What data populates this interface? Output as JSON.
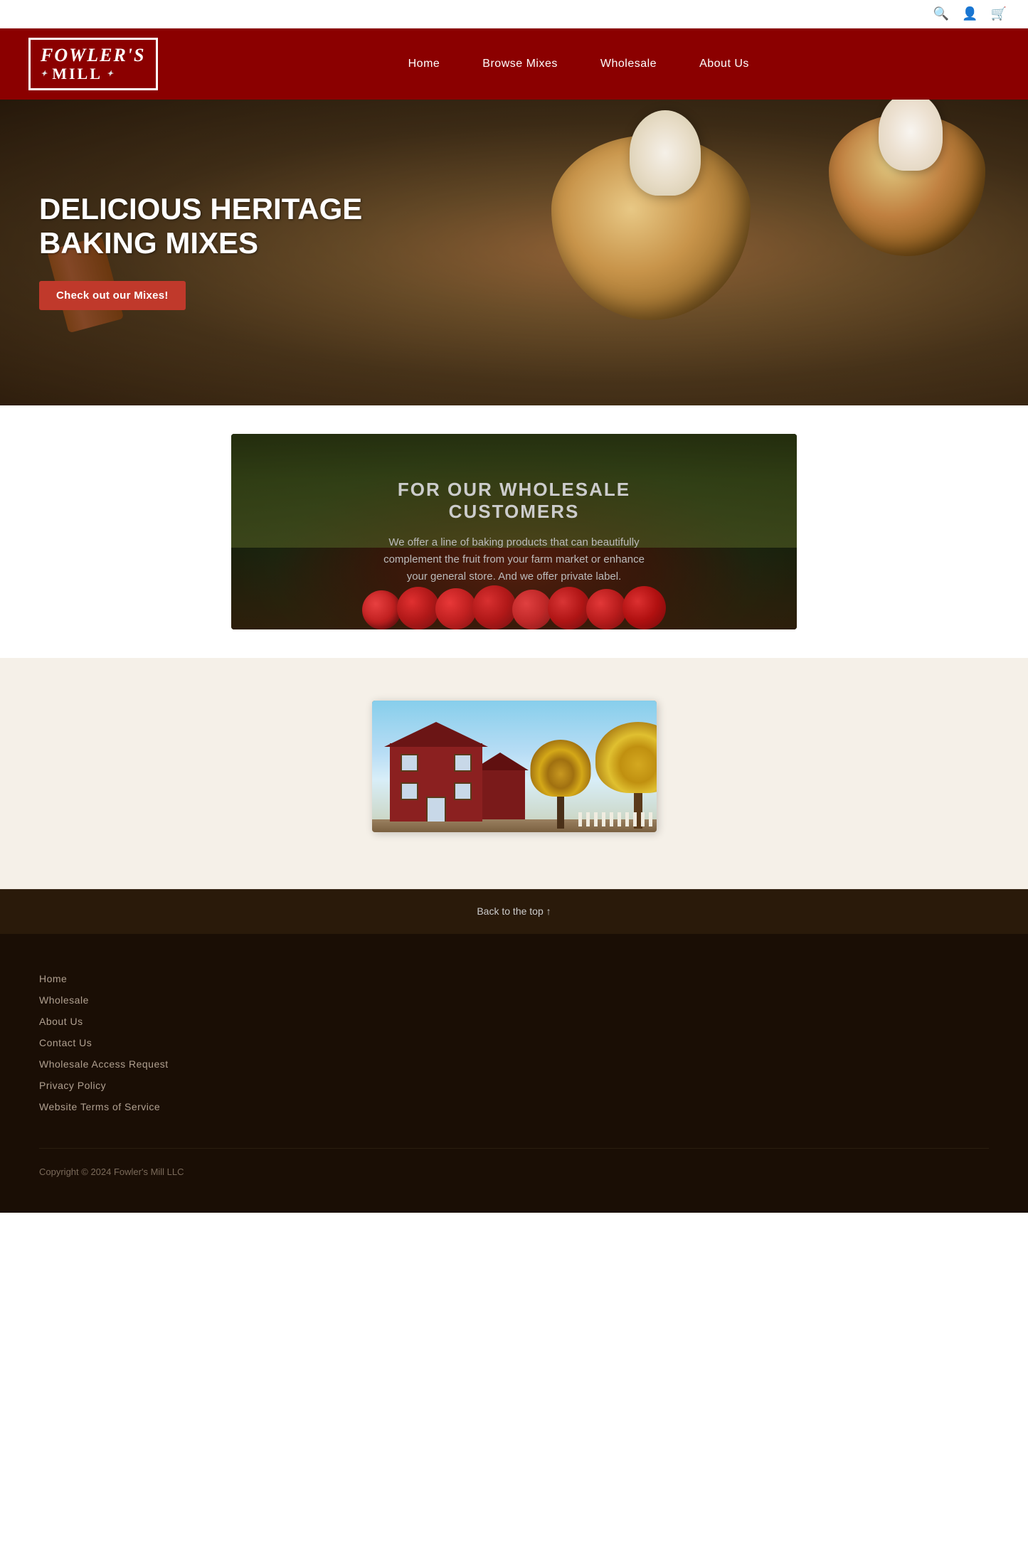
{
  "topbar": {
    "search_icon": "🔍",
    "account_icon": "👤",
    "cart_icon": "🛒"
  },
  "header": {
    "logo_line1": "Fowler's",
    "logo_line2": "Mill",
    "nav": {
      "items": [
        {
          "label": "Home",
          "href": "#"
        },
        {
          "label": "Browse Mixes",
          "href": "#"
        },
        {
          "label": "Wholesale",
          "href": "#"
        },
        {
          "label": "About Us",
          "href": "#"
        }
      ]
    }
  },
  "hero": {
    "title_line1": "DELICIOUS HERITAGE",
    "title_line2": "BAKING MIXES",
    "cta_button": "Check out our Mixes!"
  },
  "wholesale": {
    "title": "FOR OUR WHOLESALE",
    "title_line2": "CUSTOMERS",
    "description": "We offer a line of baking products that can beautifully complement the fruit from your farm market or enhance your general store. And we offer private label."
  },
  "about": {
    "image_alt": "Fowler's Mill Building in Autumn"
  },
  "footer": {
    "back_to_top": "Back to the top ↑",
    "links": [
      {
        "label": "Home",
        "href": "#"
      },
      {
        "label": "Wholesale",
        "href": "#"
      },
      {
        "label": "About Us",
        "href": "#"
      },
      {
        "label": "Contact Us",
        "href": "#"
      },
      {
        "label": "Wholesale Access Request",
        "href": "#"
      },
      {
        "label": "Privacy Policy",
        "href": "#"
      },
      {
        "label": "Website Terms of Service",
        "href": "#"
      }
    ],
    "copyright": "Copyright © 2024 Fowler's Mill LLC"
  }
}
